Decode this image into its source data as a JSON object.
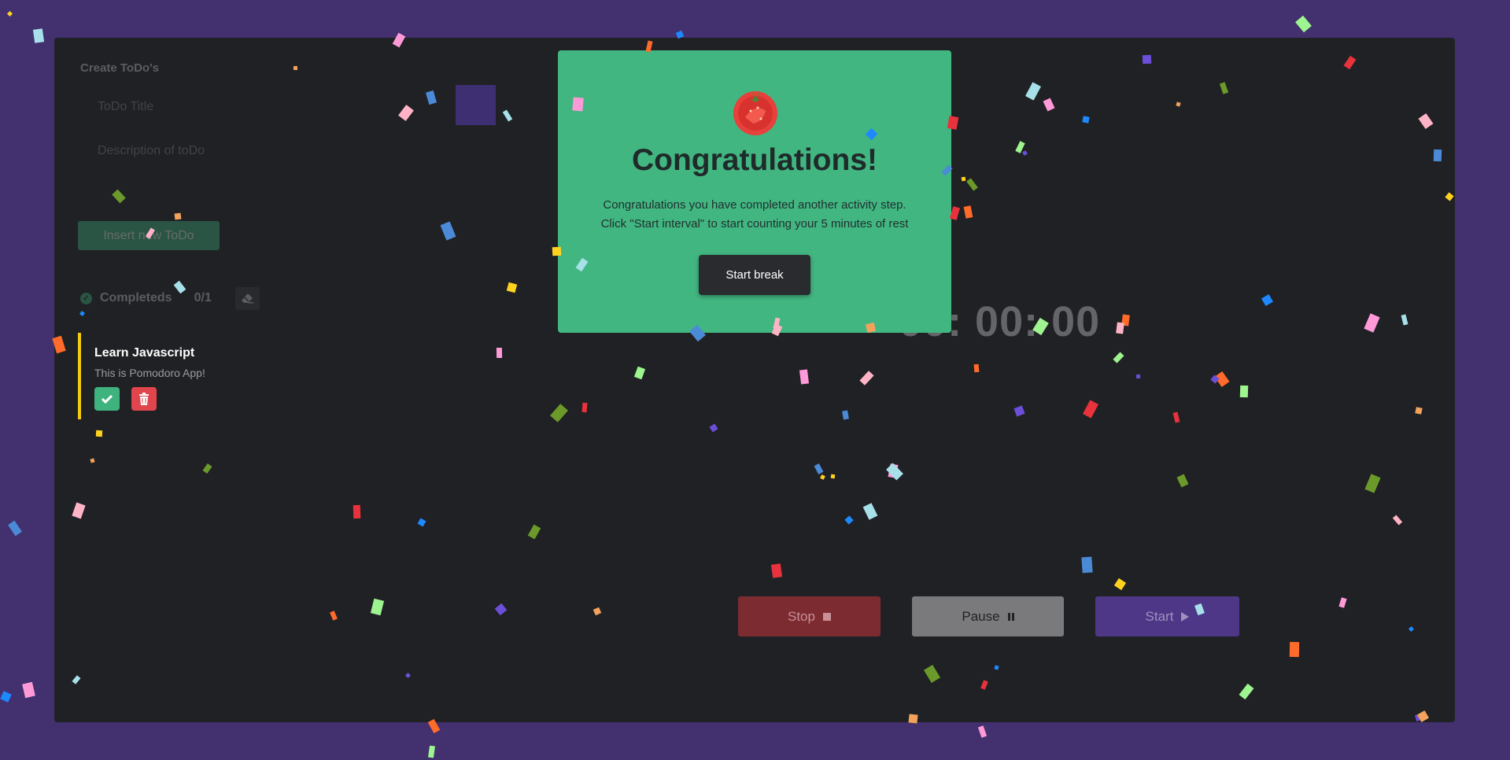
{
  "todo_form": {
    "heading": "Create ToDo's",
    "title_placeholder": "ToDo Title",
    "description_placeholder": "Description of toDo",
    "insert_button": "Insert new ToDo"
  },
  "completed": {
    "label": "Completeds",
    "count": "0/1"
  },
  "todos": [
    {
      "title": "Learn Javascript",
      "description": "This is Pomodoro App!"
    }
  ],
  "timer": {
    "display": "00: 00: 00",
    "stop_label": "Stop",
    "pause_label": "Pause",
    "start_label": "Start"
  },
  "modal": {
    "icon": "tomato-icon",
    "title": "Congratulations!",
    "message_line1": "Congratulations you have completed another activity step.",
    "message_line2": "Click \"Start interval\" to start counting your 5 minutes of rest",
    "button": "Start break"
  },
  "colors": {
    "background": "#42306f",
    "panel": "#202124",
    "modal": "#42b681",
    "accent_green": "#3fb37d",
    "accent_red": "#e0454d",
    "accent_purple": "#4f3788",
    "todo_border": "#f2cc12"
  }
}
